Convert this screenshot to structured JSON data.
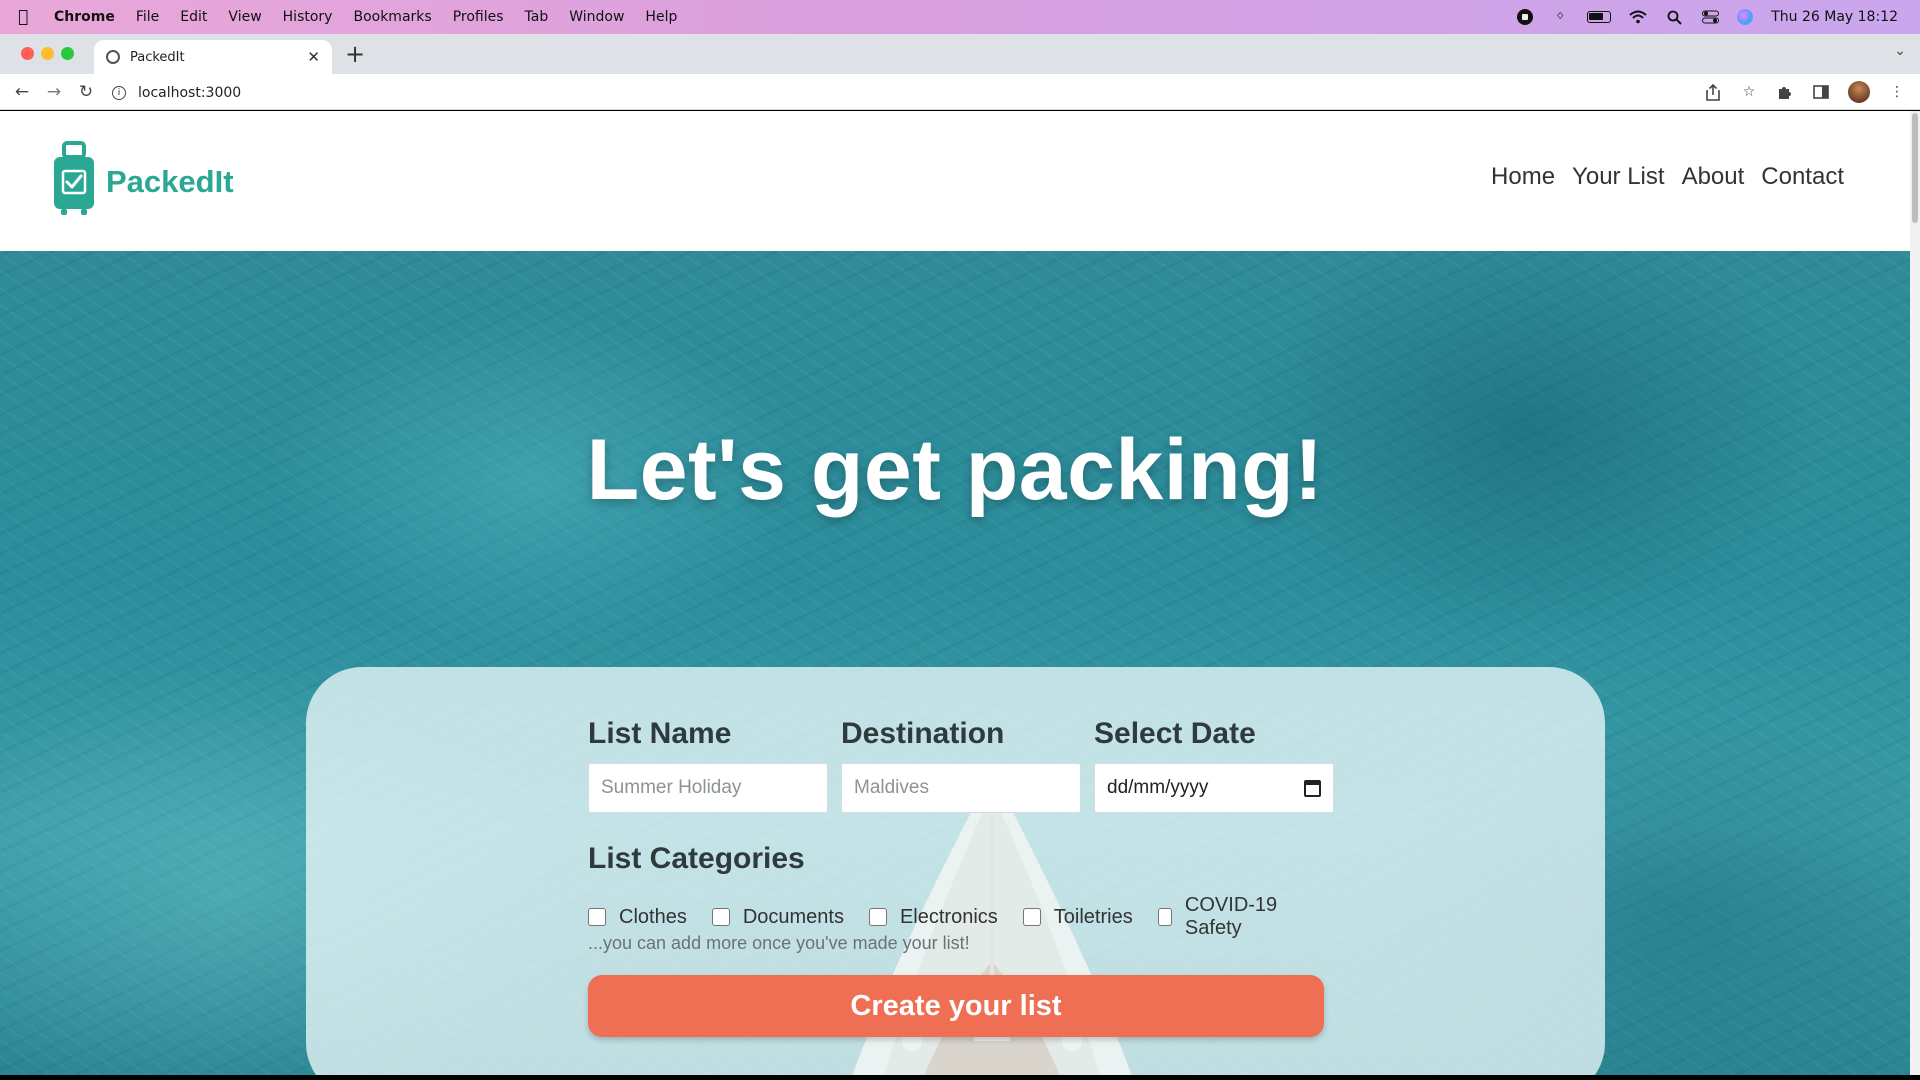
{
  "menubar": {
    "app": "Chrome",
    "items": [
      "File",
      "Edit",
      "View",
      "History",
      "Bookmarks",
      "Profiles",
      "Tab",
      "Window",
      "Help"
    ],
    "clock": "Thu 26 May  18:12"
  },
  "browser": {
    "tab_title": "PackedIt",
    "url": "localhost:3000"
  },
  "site": {
    "logo_text": "PackedIt",
    "nav": [
      "Home",
      "Your List",
      "About",
      "Contact"
    ]
  },
  "hero": {
    "title": "Let's get packing!"
  },
  "form": {
    "list_name_label": "List Name",
    "list_name_placeholder": "Summer Holiday",
    "destination_label": "Destination",
    "destination_placeholder": "Maldives",
    "date_label": "Select Date",
    "date_placeholder": "dd/mm/yyyy",
    "categories_label": "List Categories",
    "categories": [
      "Clothes",
      "Documents",
      "Electronics",
      "Toiletries",
      "COVID-19 Safety"
    ],
    "hint": "...you can add more once you've made your list!",
    "submit_label": "Create your list"
  },
  "colors": {
    "brand": "#2aa893",
    "cta": "#ef6f55"
  }
}
